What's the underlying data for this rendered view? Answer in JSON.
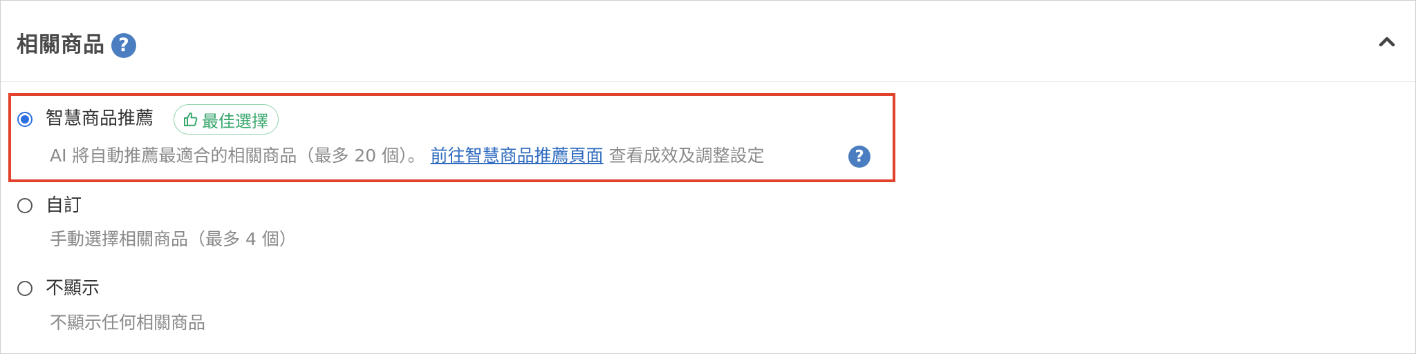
{
  "section": {
    "title": "相關商品",
    "title_help_glyph": "?"
  },
  "options": [
    {
      "id": "smart",
      "label": "智慧商品推薦",
      "selected": true,
      "badge": "最佳選擇",
      "description_prefix": "AI 將自動推薦最適合的相關商品（最多 20 個）。",
      "link_text": "前往智慧商品推薦頁面",
      "description_suffix": "查看成效及調整設定",
      "help_glyph": "?"
    },
    {
      "id": "custom",
      "label": "自訂",
      "selected": false,
      "description": "手動選擇相關商品（最多 4 個）"
    },
    {
      "id": "hide",
      "label": "不顯示",
      "selected": false,
      "description": "不顯示任何相關商品"
    }
  ],
  "colors": {
    "accent": "#2d6fe0",
    "help_icon": "#4a7ec0",
    "badge_green": "#3aa76d",
    "link": "#2f6bbf",
    "highlight": "#e2422c"
  },
  "icons": {
    "collapse": "chevron-up-icon",
    "help": "question-circle-icon",
    "badge": "thumbs-up-icon"
  }
}
